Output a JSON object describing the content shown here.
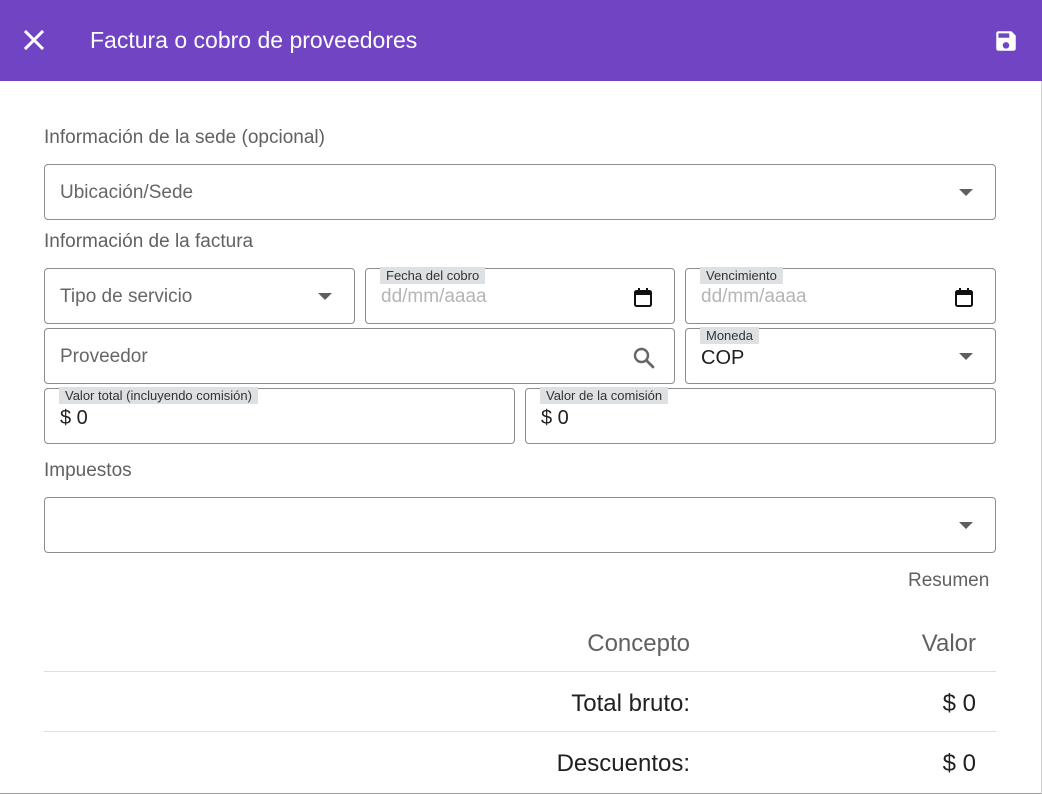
{
  "header": {
    "title": "Factura o cobro de proveedores",
    "close_icon": "close-icon",
    "save_icon": "save-icon",
    "bg_color": "#7144c4"
  },
  "site_section": {
    "label": "Información de la sede (opcional)",
    "location_placeholder": "Ubicación/Sede"
  },
  "invoice_section": {
    "label": "Información de la factura",
    "service_type_placeholder": "Tipo de servicio",
    "charge_date_label": "Fecha del cobro",
    "charge_date_placeholder": "dd/mm/aaaa",
    "due_date_label": "Vencimiento",
    "due_date_placeholder": "dd/mm/aaaa",
    "supplier_placeholder": "Proveedor",
    "currency_label": "Moneda",
    "currency_value": "COP",
    "total_label": "Valor total (incluyendo comisión)",
    "total_value": "$ 0",
    "commission_label": "Valor de la comisión",
    "commission_value": "$ 0"
  },
  "taxes_section": {
    "label": "Impuestos"
  },
  "summary": {
    "title": "Resumen",
    "columns": {
      "concept": "Concepto",
      "value": "Valor"
    },
    "rows": [
      {
        "concept": "Total bruto:",
        "value": "$ 0"
      },
      {
        "concept": "Descuentos:",
        "value": "$ 0"
      }
    ]
  }
}
